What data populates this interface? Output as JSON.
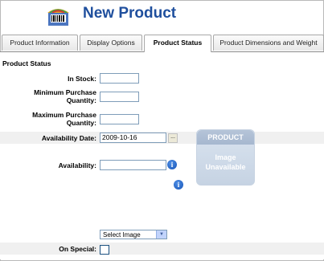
{
  "header": {
    "title": "New Product",
    "logo_icon": "product-box-icon"
  },
  "tabs": [
    {
      "label": "Product Information"
    },
    {
      "label": "Display Options"
    },
    {
      "label": "Product Status"
    },
    {
      "label": "Product Dimensions and Weight"
    }
  ],
  "section": {
    "title": "Product Status"
  },
  "fields": {
    "in_stock": {
      "label": "In Stock:",
      "value": ""
    },
    "min_qty": {
      "label_line1": "Minimum Purchase",
      "label_line2": "Quantity:",
      "value": ""
    },
    "max_qty": {
      "label_line1": "Maximum Purchase",
      "label_line2": "Quantity:",
      "value": ""
    },
    "availability_date": {
      "label": "Availability Date:",
      "value": "2009-10-16",
      "button": "..."
    },
    "availability": {
      "label": "Availability:",
      "value": ""
    },
    "image_select": {
      "value": "Select Image"
    },
    "on_special": {
      "label": "On Special:",
      "checked": false
    }
  },
  "placeholder_image": {
    "line1": "PRODUCT",
    "line2": "Image",
    "line3": "Unavailable"
  },
  "colors": {
    "title": "#1f4f9d",
    "info_icon": "#1553b5"
  }
}
